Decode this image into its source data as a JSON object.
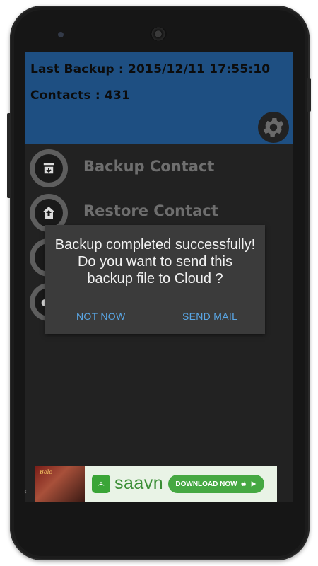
{
  "header": {
    "last_backup": "Last Backup : 2015/12/11 17:55:10",
    "contacts": "Contacts : 431"
  },
  "menu": {
    "items": [
      {
        "label": "Backup Contact",
        "icon": "archive-download-icon"
      },
      {
        "label": "Restore Contact",
        "icon": "upload-home-icon"
      },
      {
        "label": "",
        "icon": "file-icon"
      },
      {
        "label": "",
        "icon": "cloud-icon"
      }
    ]
  },
  "dialog": {
    "line1": "Backup completed successfully!",
    "line2": "Do you want to send this",
    "line3": "backup file to Cloud ?",
    "negative": "NOT NOW",
    "positive": "SEND MAIL"
  },
  "ad": {
    "thumb_text": "Bolo",
    "brand": "saavn",
    "cta": "DOWNLOAD NOW"
  },
  "colors": {
    "header_bg": "#1e4f82",
    "dialog_bg": "#3b3b3b",
    "dialog_button": "#5aa7e6",
    "ad_green": "#45a842"
  }
}
